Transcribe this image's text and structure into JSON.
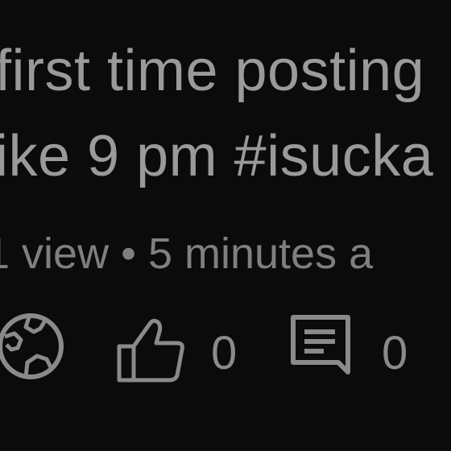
{
  "post": {
    "title_line1": "first time posting",
    "title_line2": "ike 9 pm #isucka",
    "meta": "1 view • 5 minutes a"
  },
  "actions": {
    "privacy_icon": "globe-icon",
    "like_icon": "thumbs-up-icon",
    "like_count": "0",
    "comment_icon": "comment-icon",
    "comment_count": "0"
  },
  "colors": {
    "background": "#0b0b0b",
    "text": "#9a9a9a",
    "icon": "#8a8a8a"
  }
}
